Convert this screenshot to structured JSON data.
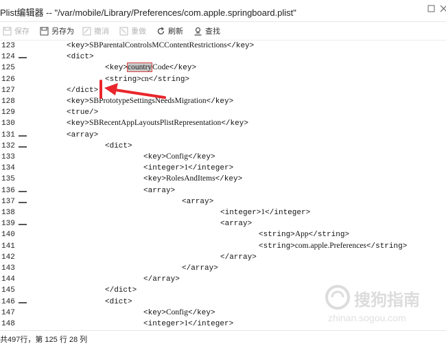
{
  "window": {
    "title": "Plist编辑器 -- \"/var/mobile/Library/Preferences/com.apple.springboard.plist\"",
    "restore_icon": "restore-icon",
    "close_icon": "close-icon"
  },
  "toolbar": {
    "save": "保存",
    "save_as": "另存为",
    "undo": "撤消",
    "redo": "重做",
    "refresh": "刷新",
    "find": "查找"
  },
  "editor": {
    "lines": [
      {
        "num": "123",
        "fold": false,
        "indent": 1,
        "parts": [
          {
            "t": "<key>",
            "m": 1
          },
          {
            "t": "SBParentalControlsMCContentRestrictions",
            "m": 0
          },
          {
            "t": "</key>",
            "m": 1
          }
        ]
      },
      {
        "num": "124",
        "fold": true,
        "indent": 1,
        "parts": [
          {
            "t": "<dict>",
            "m": 1
          }
        ]
      },
      {
        "num": "125",
        "fold": false,
        "indent": 2,
        "parts": [
          {
            "t": "<key>",
            "m": 1
          },
          {
            "t": "country",
            "m": 0,
            "sel": true
          },
          {
            "t": "Code",
            "m": 0
          },
          {
            "t": "</key>",
            "m": 1
          }
        ]
      },
      {
        "num": "126",
        "fold": false,
        "indent": 2,
        "parts": [
          {
            "t": "<string>",
            "m": 1
          },
          {
            "t": "cn",
            "m": 0
          },
          {
            "t": "</string>",
            "m": 1
          }
        ]
      },
      {
        "num": "127",
        "fold": false,
        "indent": 1,
        "parts": [
          {
            "t": "</dict>",
            "m": 1
          }
        ]
      },
      {
        "num": "128",
        "fold": false,
        "indent": 1,
        "parts": [
          {
            "t": "<key>",
            "m": 1
          },
          {
            "t": "SBPrototypeSettingsNeedsMigration",
            "m": 0
          },
          {
            "t": "</key>",
            "m": 1
          }
        ]
      },
      {
        "num": "129",
        "fold": false,
        "indent": 1,
        "parts": [
          {
            "t": "<true/>",
            "m": 1
          }
        ]
      },
      {
        "num": "130",
        "fold": false,
        "indent": 1,
        "parts": [
          {
            "t": "<key>",
            "m": 1
          },
          {
            "t": "SBRecentAppLayoutsPlistRepresentation",
            "m": 0
          },
          {
            "t": "</key>",
            "m": 1
          }
        ]
      },
      {
        "num": "131",
        "fold": true,
        "indent": 1,
        "parts": [
          {
            "t": "<array>",
            "m": 1
          }
        ]
      },
      {
        "num": "132",
        "fold": true,
        "indent": 2,
        "parts": [
          {
            "t": "<dict>",
            "m": 1
          }
        ]
      },
      {
        "num": "133",
        "fold": false,
        "indent": 3,
        "parts": [
          {
            "t": "<key>",
            "m": 1
          },
          {
            "t": "Config",
            "m": 0
          },
          {
            "t": "</key>",
            "m": 1
          }
        ]
      },
      {
        "num": "134",
        "fold": false,
        "indent": 3,
        "parts": [
          {
            "t": "<integer>",
            "m": 1
          },
          {
            "t": "1",
            "m": 0
          },
          {
            "t": "</integer>",
            "m": 1
          }
        ]
      },
      {
        "num": "135",
        "fold": false,
        "indent": 3,
        "parts": [
          {
            "t": "<key>",
            "m": 1
          },
          {
            "t": "RolesAndItems",
            "m": 0
          },
          {
            "t": "</key>",
            "m": 1
          }
        ]
      },
      {
        "num": "136",
        "fold": true,
        "indent": 3,
        "parts": [
          {
            "t": "<array>",
            "m": 1
          }
        ]
      },
      {
        "num": "137",
        "fold": true,
        "indent": 4,
        "parts": [
          {
            "t": "<array>",
            "m": 1
          }
        ]
      },
      {
        "num": "138",
        "fold": false,
        "indent": 5,
        "parts": [
          {
            "t": "<integer>",
            "m": 1
          },
          {
            "t": "1",
            "m": 0
          },
          {
            "t": "</integer>",
            "m": 1
          }
        ]
      },
      {
        "num": "139",
        "fold": true,
        "indent": 5,
        "parts": [
          {
            "t": "<array>",
            "m": 1
          }
        ]
      },
      {
        "num": "140",
        "fold": false,
        "indent": 6,
        "parts": [
          {
            "t": "<string>",
            "m": 1
          },
          {
            "t": "App",
            "m": 0
          },
          {
            "t": "</string>",
            "m": 1
          }
        ]
      },
      {
        "num": "141",
        "fold": false,
        "indent": 6,
        "parts": [
          {
            "t": "<string>",
            "m": 1
          },
          {
            "t": "com.apple.Preferences",
            "m": 0
          },
          {
            "t": "</string>",
            "m": 1
          }
        ]
      },
      {
        "num": "142",
        "fold": false,
        "indent": 5,
        "parts": [
          {
            "t": "</array>",
            "m": 1
          }
        ]
      },
      {
        "num": "143",
        "fold": false,
        "indent": 4,
        "parts": [
          {
            "t": "</array>",
            "m": 1
          }
        ]
      },
      {
        "num": "144",
        "fold": false,
        "indent": 3,
        "parts": [
          {
            "t": "</array>",
            "m": 1
          }
        ]
      },
      {
        "num": "145",
        "fold": false,
        "indent": 2,
        "parts": [
          {
            "t": "</dict>",
            "m": 1
          }
        ]
      },
      {
        "num": "146",
        "fold": true,
        "indent": 2,
        "parts": [
          {
            "t": "<dict>",
            "m": 1
          }
        ]
      },
      {
        "num": "147",
        "fold": false,
        "indent": 3,
        "parts": [
          {
            "t": "<key>",
            "m": 1
          },
          {
            "t": "Config",
            "m": 0
          },
          {
            "t": "</key>",
            "m": 1
          }
        ]
      },
      {
        "num": "148",
        "fold": false,
        "indent": 3,
        "parts": [
          {
            "t": "<integer>",
            "m": 1
          },
          {
            "t": "1",
            "m": 0
          },
          {
            "t": "</integer>",
            "m": 1
          }
        ]
      }
    ]
  },
  "status": {
    "text": "共497行，第 125 行 28 列"
  },
  "annotation": {
    "arrow_color": "#e8262b"
  },
  "watermark": {
    "brand": "搜狗指南",
    "url": "zhinan.sogou.com"
  }
}
